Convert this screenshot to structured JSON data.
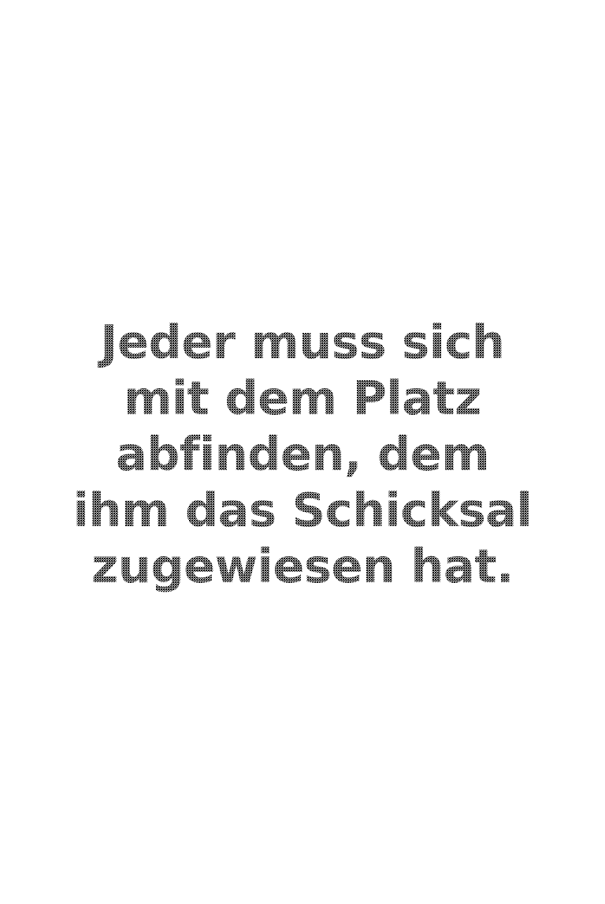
{
  "quote": {
    "lines": [
      "Jeder muss sich",
      "mit dem Platz",
      "abfinden, dem",
      "ihm das Schicksal",
      "zugewiesen hat."
    ]
  },
  "colors": {
    "background": "#ffffff",
    "text": "#2a2a2a"
  }
}
